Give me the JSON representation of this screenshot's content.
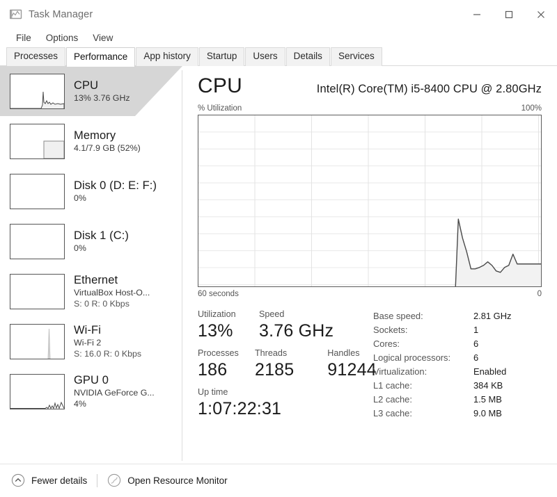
{
  "window": {
    "title": "Task Manager",
    "icon": "task-manager-icon",
    "controls": {
      "minimize": "─",
      "maximize": "☐",
      "close": "✕"
    }
  },
  "menu": {
    "items": [
      "File",
      "Options",
      "View"
    ]
  },
  "tabs": {
    "items": [
      "Processes",
      "Performance",
      "App history",
      "Startup",
      "Users",
      "Details",
      "Services"
    ],
    "active": "Performance"
  },
  "sidebar": {
    "items": [
      {
        "name": "CPU",
        "line1": "13%  3.76 GHz",
        "line2": "",
        "selected": true,
        "thumb": "cpu-sparkline"
      },
      {
        "name": "Memory",
        "line1": "4.1/7.9 GB (52%)",
        "line2": "",
        "selected": false,
        "thumb": "memory-block"
      },
      {
        "name": "Disk 0 (D: E: F:)",
        "line1": "0%",
        "line2": "",
        "selected": false,
        "thumb": "flat-line"
      },
      {
        "name": "Disk 1 (C:)",
        "line1": "0%",
        "line2": "",
        "selected": false,
        "thumb": "flat-line"
      },
      {
        "name": "Ethernet",
        "line1": "VirtualBox Host-O...",
        "line2": "S: 0 R: 0 Kbps",
        "selected": false,
        "thumb": "flat-empty"
      },
      {
        "name": "Wi-Fi",
        "line1": "Wi-Fi 2",
        "line2": "S: 16.0 R: 0 Kbps",
        "selected": false,
        "thumb": "wifi-spike"
      },
      {
        "name": "GPU 0",
        "line1": "NVIDIA GeForce G...",
        "line2": "4%",
        "selected": false,
        "thumb": "gpu-sparkline"
      }
    ]
  },
  "main": {
    "title": "CPU",
    "model": "Intel(R) Core(TM) i5-8400 CPU @ 2.80GHz",
    "graph_label_left": "% Utilization",
    "graph_label_right": "100%",
    "axis_left": "60 seconds",
    "axis_right": "0"
  },
  "stats": {
    "utilization_label": "Utilization",
    "utilization_value": "13%",
    "speed_label": "Speed",
    "speed_value": "3.76 GHz",
    "processes_label": "Processes",
    "processes_value": "186",
    "threads_label": "Threads",
    "threads_value": "2185",
    "handles_label": "Handles",
    "handles_value": "91244",
    "uptime_label": "Up time",
    "uptime_value": "1:07:22:31"
  },
  "specs": [
    {
      "key": "Base speed:",
      "value": "2.81 GHz"
    },
    {
      "key": "Sockets:",
      "value": "1"
    },
    {
      "key": "Cores:",
      "value": "6"
    },
    {
      "key": "Logical processors:",
      "value": "6"
    },
    {
      "key": "Virtualization:",
      "value": "Enabled"
    },
    {
      "key": "L1 cache:",
      "value": "384 KB"
    },
    {
      "key": "L2 cache:",
      "value": "1.5 MB"
    },
    {
      "key": "L3 cache:",
      "value": "9.0 MB"
    }
  ],
  "footer": {
    "fewer_details": "Fewer details",
    "open_resource_monitor": "Open Resource Monitor"
  },
  "colors": {
    "selection": "#d6d6d6",
    "graph_line": "#4a4a4a",
    "graph_fill": "#f2f2f2",
    "grid": "#e3e3e3",
    "border": "#5c5c5c"
  },
  "chart_data": {
    "type": "area",
    "title": "% Utilization",
    "xlabel": "60 seconds",
    "ylabel": "% Utilization",
    "xlim": [
      60,
      0
    ],
    "ylim": [
      0,
      100
    ],
    "grid": true,
    "legend": null,
    "note": "Data present only for the most recent ~15 seconds; earlier samples empty.",
    "x": [
      60,
      59,
      58,
      57,
      56,
      55,
      54,
      53,
      52,
      51,
      50,
      49,
      48,
      47,
      46,
      45,
      44,
      43,
      42,
      41,
      40,
      39,
      38,
      37,
      36,
      35,
      34,
      33,
      32,
      31,
      30,
      29,
      28,
      27,
      26,
      25,
      24,
      23,
      22,
      21,
      20,
      19,
      18,
      17,
      16,
      15,
      14,
      13,
      12,
      11,
      10,
      9,
      8,
      7,
      6,
      5,
      4,
      3,
      2,
      1,
      0
    ],
    "series": [
      {
        "name": "CPU utilization",
        "values": [
          null,
          null,
          null,
          null,
          null,
          null,
          null,
          null,
          null,
          null,
          null,
          null,
          null,
          null,
          null,
          null,
          null,
          null,
          null,
          null,
          null,
          null,
          null,
          null,
          null,
          null,
          null,
          null,
          null,
          null,
          null,
          null,
          null,
          null,
          null,
          null,
          null,
          null,
          null,
          null,
          null,
          null,
          null,
          null,
          null,
          0,
          38,
          28,
          19,
          10,
          10,
          11,
          12,
          14,
          12,
          9,
          8,
          11,
          12,
          19,
          13
        ]
      }
    ]
  }
}
